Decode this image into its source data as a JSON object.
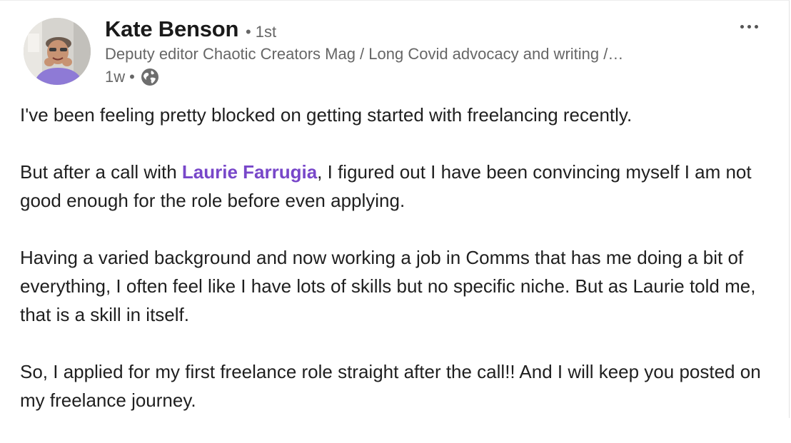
{
  "post": {
    "author": {
      "name": "Kate Benson",
      "connection_degree": "1st",
      "headline": "Deputy editor Chaotic Creators Mag / Long Covid advocacy and writing /…",
      "posted_ago": "1w",
      "visibility_icon": "globe-icon"
    },
    "menu_icon": "more-options-icon",
    "paragraphs": [
      {
        "text": "I've been feeling pretty blocked on getting started with freelancing recently."
      },
      {
        "before": "But after a call with ",
        "mention": "Laurie Farrugia",
        "after": ", I figured out I have been convincing myself I am not good enough for the role before even applying."
      },
      {
        "text": "Having a varied background and now working a job in Comms that has me doing a bit of everything, I often feel like I have lots of skills but no specific niche. But as Laurie told me, that is a skill in itself."
      },
      {
        "text": "So, I applied for my first freelance role straight after the call!! And I will keep you posted on my freelance journey."
      }
    ]
  },
  "colors": {
    "mention": "#7847c9",
    "secondary_text": "#666666",
    "primary_text": "#1f1f1f"
  }
}
